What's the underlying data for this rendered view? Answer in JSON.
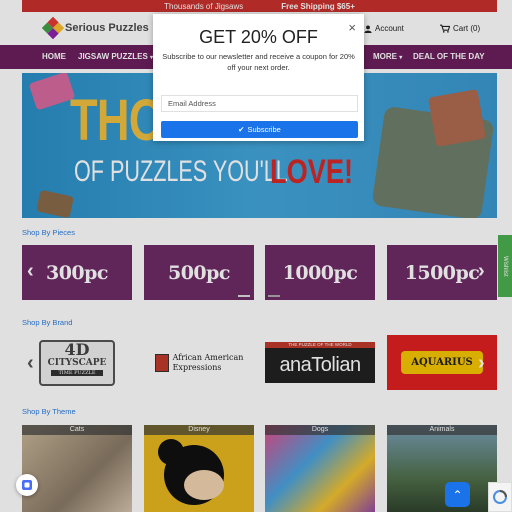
{
  "topbar": {
    "left_text": "Thousands of Jigsaws",
    "right_text": "Free Shipping $65+"
  },
  "header": {
    "logo_text": "Serious Puzzles",
    "account_label": "Account",
    "cart_label": "Cart (0)"
  },
  "nav": {
    "items": [
      "HOME",
      "JIGSAW PUZZLES",
      "MORE",
      "DEAL OF THE DAY"
    ]
  },
  "hero": {
    "line1": "THOUSANDS",
    "line2": "OF PUZZLES YOU'LL",
    "line3": "LOVE!"
  },
  "sections": {
    "pieces_title": "Shop By Pieces",
    "brand_title": "Shop By Brand",
    "theme_title": "Shop By Theme"
  },
  "pieces": [
    "300pc",
    "500pc",
    "1000pc",
    "1500pc"
  ],
  "brands": {
    "b1_top": "4D",
    "b1_mid": "CITYSCAPE",
    "b1_bot": "TIME PUZZLE",
    "b2_line1": "African American",
    "b2_line2": "Expressions",
    "b3_top": "THE PUZZLE OF THE WORLD",
    "b3_main": "anaTolian",
    "b4_main": "AQUARIUS"
  },
  "themes": [
    "Cats",
    "Disney",
    "Dogs",
    "Animals"
  ],
  "wishlist_label": "Wishlist",
  "modal": {
    "title": "GET 20% OFF",
    "description": "Subscribe to our newsletter and receive a coupon for 20% off your next order.",
    "email_placeholder": "Email Address",
    "subscribe_label": "Subscribe",
    "close_symbol": "×"
  },
  "colors": {
    "nav": "#6b1f5d",
    "topbar": "#c9322e",
    "button": "#1a73e8",
    "tile": "#6e2b66"
  }
}
